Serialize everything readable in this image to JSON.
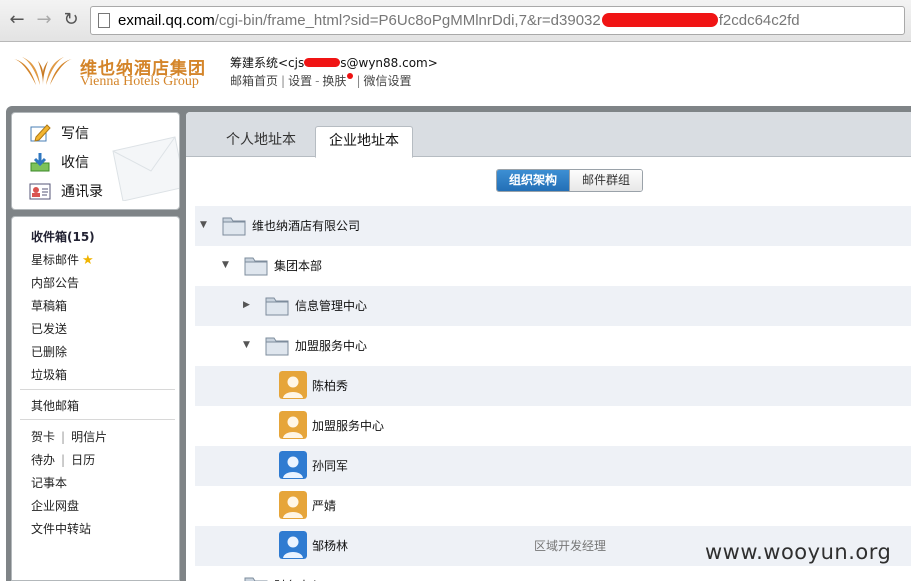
{
  "browser": {
    "back_icon": "arrow-left-icon",
    "forward_icon": "arrow-right-icon",
    "reload_icon": "reload-icon",
    "url_host": "exmail.qq.com",
    "url_path_start": "/cgi-bin/frame_html?sid=P6Uc8oPgMMlnrDdi,7&r=d39032",
    "url_path_end": "f2cdc64c2fd"
  },
  "header": {
    "logo_cn": "维也纳酒店集团",
    "logo_en": "Vienna Hotels Group",
    "account_prefix": "筹建系统<cjs",
    "account_suffix": "s@wyn88.com>",
    "links": [
      "邮箱首页",
      "设置",
      "换肤",
      "微信设置"
    ]
  },
  "quick": {
    "compose": "写信",
    "receive": "收信",
    "contacts": "通讯录"
  },
  "folders": {
    "inbox": "收件箱(15)",
    "starred": "星标邮件",
    "bulletin": "内部公告",
    "drafts": "草稿箱",
    "sent": "已发送",
    "deleted": "已删除",
    "spam": "垃圾箱",
    "other": "其他邮箱",
    "cards": "贺卡",
    "postcards": "明信片",
    "todo": "待办",
    "calendar": "日历",
    "notes": "记事本",
    "disk": "企业网盘",
    "transfer": "文件中转站"
  },
  "tabs": {
    "personal": "个人地址本",
    "enterprise": "企业地址本"
  },
  "segment": {
    "org": "组织架构",
    "groups": "邮件群组"
  },
  "tree": [
    {
      "label": "维也纳酒店有限公司",
      "type": "folder",
      "state": "expanded",
      "level": 0
    },
    {
      "label": "集团本部",
      "type": "folder",
      "state": "expanded",
      "level": 1
    },
    {
      "label": "信息管理中心",
      "type": "folder",
      "state": "collapsed",
      "level": 2
    },
    {
      "label": "加盟服务中心",
      "type": "folder",
      "state": "expanded",
      "level": 2
    },
    {
      "label": "陈柏秀",
      "type": "user-female",
      "title": ""
    },
    {
      "label": "加盟服务中心",
      "type": "user-female",
      "title": ""
    },
    {
      "label": "孙同军",
      "type": "user-male",
      "title": ""
    },
    {
      "label": "严婧",
      "type": "user-female",
      "title": ""
    },
    {
      "label": "邹杨林",
      "type": "user-male",
      "title": "区域开发经理"
    },
    {
      "label": "财务中心",
      "type": "folder",
      "state": "collapsed",
      "level": 1
    }
  ],
  "watermark": "www.wooyun.org",
  "colors": {
    "brand_gold": "#d4852a",
    "accent_blue": "#2a78bf",
    "frame_gray": "#7f8487"
  }
}
